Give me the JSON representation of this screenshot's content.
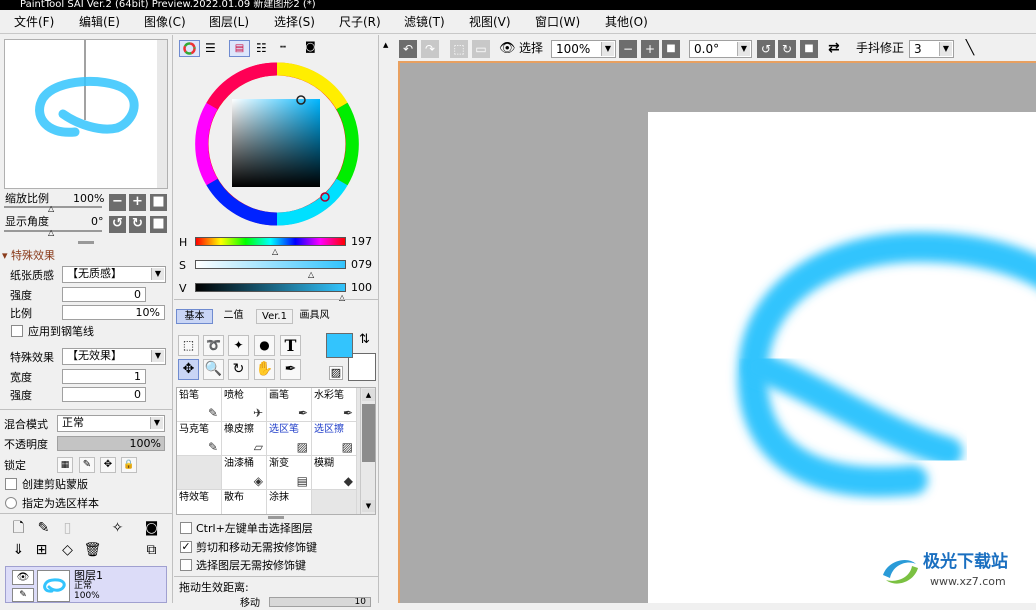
{
  "title": "PaintTool SAI Ver.2 (64bit) Preview.2022.01.09 新建图形2 (*)",
  "menu": [
    "文件(F)",
    "编辑(E)",
    "图像(C)",
    "图层(L)",
    "选择(S)",
    "尺子(R)",
    "滤镜(T)",
    "视图(V)",
    "窗口(W)",
    "其他(O)"
  ],
  "navigator": {
    "zoom_label": "缩放比例",
    "zoom_value": "100%",
    "angle_label": "显示角度",
    "angle_value": "0°"
  },
  "effects": {
    "header": "特殊效果",
    "paper_label": "纸张质感",
    "paper_value": "【无质感】",
    "strength_label": "强度",
    "strength_value": "0",
    "ratio_label": "比例",
    "ratio_value": "10%",
    "apply_pen_label": "应用到钢笔线",
    "effect_label": "特殊效果",
    "effect_value": "【无效果】",
    "width_label": "宽度",
    "width_value": "1",
    "strength2_label": "强度",
    "strength2_value": "0"
  },
  "layer_props": {
    "blend_label": "混合模式",
    "blend_value": "正常",
    "opacity_label": "不透明度",
    "opacity_value": "100%",
    "lock_label": "锁定",
    "clip_label": "创建剪贴蒙版",
    "sample_label": "指定为选区样本"
  },
  "layer": {
    "name": "图层1",
    "mode": "正常",
    "opacity": "100%"
  },
  "color": {
    "h_label": "H",
    "h_value": "197",
    "s_label": "S",
    "s_value": "079",
    "v_label": "V",
    "v_value": "100",
    "main_color": "#33c4fd"
  },
  "tool_tabs": [
    "基本",
    "二值",
    "Ver.1",
    "画具风"
  ],
  "brushes": [
    {
      "label": "铅笔",
      "icon": "✎"
    },
    {
      "label": "喷枪",
      "icon": "✈"
    },
    {
      "label": "画笔",
      "icon": "✒"
    },
    {
      "label": "水彩笔",
      "icon": "✒"
    },
    {
      "label": "马克笔",
      "icon": "✎"
    },
    {
      "label": "橡皮擦",
      "icon": "▱"
    },
    {
      "label": "选区笔",
      "icon": "▨"
    },
    {
      "label": "选区擦",
      "icon": "▨"
    },
    {
      "label": "",
      "icon": ""
    },
    {
      "label": "油漆桶",
      "icon": "◈"
    },
    {
      "label": "渐变",
      "icon": "▤"
    },
    {
      "label": "模糊",
      "icon": "◆"
    },
    {
      "label": "特效笔",
      "icon": ""
    },
    {
      "label": "散布",
      "icon": ""
    },
    {
      "label": "涂抹",
      "icon": ""
    },
    {
      "label": "",
      "icon": ""
    }
  ],
  "options": {
    "opt1": "Ctrl+左键单击选择图层",
    "opt2": "剪切和移动无需按修饰键",
    "opt3": "选择图层无需按修饰键",
    "drag_label": "拖动生效距离:",
    "drag_sub": "移动",
    "drag_value": "10"
  },
  "toolbar": {
    "select_label": "选择",
    "zoom_value": "100%",
    "angle_value": "0.0°",
    "stab_label": "手抖修正",
    "stab_value": "3"
  },
  "watermark": {
    "name": "极光下载站",
    "url": "www.xz7.com"
  }
}
